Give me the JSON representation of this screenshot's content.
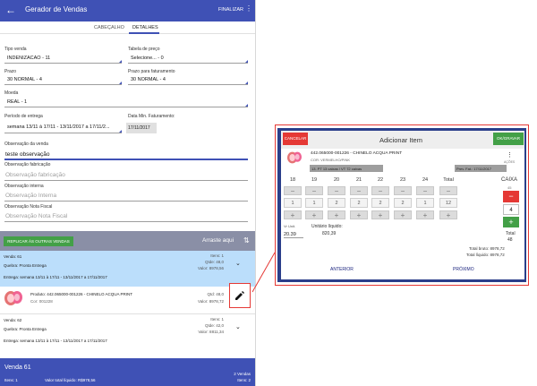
{
  "appbar": {
    "title": "Gerador de Vendas",
    "back_icon": "arrow-left-icon",
    "finalizar": "FINALIZAR",
    "menu_icon": "kebab-icon"
  },
  "tabs": [
    {
      "label": "CABEÇALHO"
    },
    {
      "label": "DETALHES"
    }
  ],
  "fields": {
    "tipo_venda": {
      "label": "Tipo venda",
      "value": "INDENIZACAO - 11"
    },
    "tabela_preco": {
      "label": "Tabela de preço",
      "value": "Selecione... - 0"
    },
    "prazo": {
      "label": "Prazo",
      "value": "30 NORMAL - 4"
    },
    "prazo_faturamento": {
      "label": "Prazo para faturamento",
      "value": "30 NORMAL - 4"
    },
    "moeda": {
      "label": "Moeda",
      "value": "REAL - 1"
    },
    "periodo_entrega": {
      "label": "Período de entrega",
      "value": "semana 13/11 à 17/11 - 13/11/2017 a 17/11/2..."
    },
    "data_faturamento": {
      "label": "Data Min. Faturamento:",
      "value": "17/11/2017"
    },
    "obs_venda": {
      "label": "Observação da venda",
      "value": "teste observação"
    },
    "obs_fabricacao": {
      "label": "Observação fabricação",
      "placeholder": "Observação fabricação"
    },
    "obs_interna": {
      "label": "Observação interna",
      "placeholder": "Observação Interna"
    },
    "obs_nota": {
      "label": "Observação Nota Fiscal",
      "placeholder": "Observação Nota Fiscal"
    }
  },
  "actions": {
    "replicar": "REPLICAR ÀS OUTRAS VENDAS",
    "arraste": "Arraste aqui",
    "sort_icon": "sort-arrows-icon"
  },
  "vendas": [
    {
      "venda": "Venda: 61",
      "quebra": "Quebra: Pronta Entrega",
      "entrega": "Entrega: semana 13/11 à 17/11 - 13/11/2017 a 17/11/2017",
      "itens": "Itens: 1",
      "qtde": "Qtde: 48,0",
      "valor": "Valor: 8978,56"
    },
    {
      "venda": "Venda: 62",
      "quebra": "Quebra: Pronta Entrega",
      "entrega": "Entrega: semana 13/11 à 17/11 - 13/11/2017 a 17/11/2017",
      "itens": "Itens: 1",
      "qtde": "Qtde: 42,0",
      "valor": "Valor: 8811,34"
    }
  ],
  "produto": {
    "nome": "Produto: 442.065000-001226 - CHINELO ACQUA PRINT",
    "cor": "Cor: 001228",
    "qtd": "Qtd: 48,0",
    "valor": "Valor: 8978,72",
    "edit_icon": "pencil-icon"
  },
  "footer": {
    "venda": "Venda 61",
    "itens": "Itens: 1",
    "valor_total": "Valor total líquido: R$978,56",
    "vendas_count": "2 Vendas",
    "itens_right": "Itens: 2"
  },
  "modal": {
    "cancel": "CANCELAR",
    "title": "Adicionar Item",
    "ok": "OK/GRAVAR",
    "product_name": "442.065000-001226 - CHINELO ACQUA PRINT",
    "product_color": "COR: VERMELHO/PINK",
    "acoes_label": "AÇÕES",
    "pill_left": "13. PT 13 caixas / VT 72 caixas",
    "pill_right": "Prev. Fat.: 17/11/2017",
    "sizes": [
      "18",
      "19",
      "20",
      "21",
      "22",
      "23",
      "24",
      "Total"
    ],
    "qty_row1": [
      "1",
      "1",
      "2",
      "2",
      "2",
      "2",
      "1",
      "12"
    ],
    "un_label": "Vr Unit.",
    "un_value": "20.39",
    "liquido_label": "Unitário líquido:",
    "liquido_value": "820,39",
    "caixa_label": "CAIXA",
    "caixa_sub": "45",
    "caixa_value": "4",
    "total_label": "Total",
    "total_value": "48",
    "total_bruto": "Total bruto: 8978,72",
    "total_liquido": "Total líquido: 8978,72",
    "anterior": "ANTERIOR",
    "proximo": "PRÓXIMO"
  },
  "colors": {
    "primary": "#3f51b5",
    "accent_red": "#e53935",
    "accent_green": "#43a047",
    "row_selected": "#bbdefb"
  }
}
